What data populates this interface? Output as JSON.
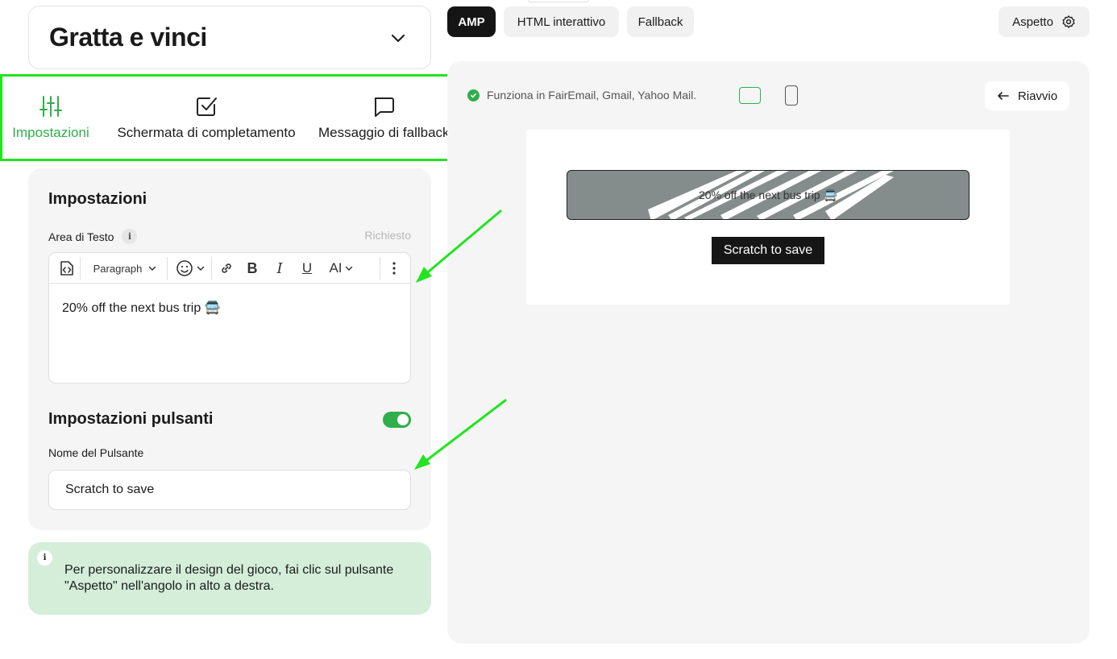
{
  "game": {
    "title": "Gratta e vinci"
  },
  "tabs": [
    {
      "label": "Impostazioni",
      "icon": "sliders-icon",
      "active": true
    },
    {
      "label": "Schermata di completamento",
      "icon": "checkbox-icon",
      "active": false
    },
    {
      "label": "Messaggio di fallback",
      "icon": "chat-bubble-icon",
      "active": false
    }
  ],
  "settings": {
    "heading": "Impostazioni",
    "text_area_label": "Area di Testo",
    "info_glyph": "i",
    "required_label": "Richiesto",
    "toolbar": {
      "paragraph": "Paragraph",
      "bold": "B",
      "italic": "I",
      "underline": "U",
      "font_size": "AI"
    },
    "text_value": "20% off the next bus trip 🚍",
    "buttons_heading": "Impostazioni pulsanti",
    "buttons_enabled": true,
    "button_name_label": "Nome del Pulsante",
    "button_name_value": "Scratch to save"
  },
  "hint": {
    "glyph": "i",
    "text": "Per personalizzare il design del gioco, fai clic sul pulsante \"Aspetto\" nell'angolo in alto a destra."
  },
  "modes": {
    "amp": "AMP",
    "html": "HTML interattivo",
    "fallback": "Fallback",
    "active": "AMP"
  },
  "appearance": {
    "label": "Aspetto"
  },
  "preview": {
    "compat_text": "Funziona in FairEmail, Gmail, Yahoo Mail.",
    "restart_label": "Riavvio",
    "scratch_text": "20% off the next bus trip 🚍",
    "scratch_button": "Scratch to save",
    "active_device": "desktop"
  },
  "colors": {
    "accent": "#2fae4a",
    "highlight": "#22e41f",
    "hint_bg": "#d4eed9",
    "scratch_cover": "#858d8c"
  }
}
